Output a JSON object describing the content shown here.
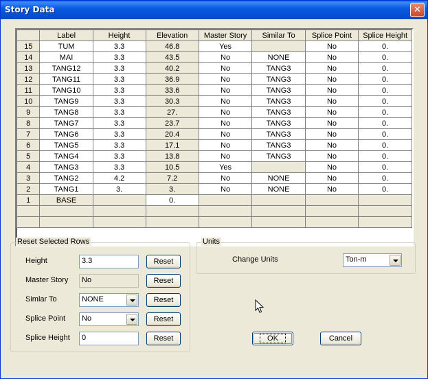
{
  "window": {
    "title": "Story Data"
  },
  "grid": {
    "headers": [
      "",
      "Label",
      "Height",
      "Elevation",
      "Master Story",
      "Similar To",
      "Splice Point",
      "Splice Height"
    ],
    "rows": [
      [
        "15",
        "TUM",
        "3.3",
        "46.8",
        "Yes",
        "",
        "No",
        "0."
      ],
      [
        "14",
        "MAI",
        "3.3",
        "43.5",
        "No",
        "NONE",
        "No",
        "0."
      ],
      [
        "13",
        "TANG12",
        "3.3",
        "40.2",
        "No",
        "TANG3",
        "No",
        "0."
      ],
      [
        "12",
        "TANG11",
        "3.3",
        "36.9",
        "No",
        "TANG3",
        "No",
        "0."
      ],
      [
        "11",
        "TANG10",
        "3.3",
        "33.6",
        "No",
        "TANG3",
        "No",
        "0."
      ],
      [
        "10",
        "TANG9",
        "3.3",
        "30.3",
        "No",
        "TANG3",
        "No",
        "0."
      ],
      [
        "9",
        "TANG8",
        "3.3",
        "27.",
        "No",
        "TANG3",
        "No",
        "0."
      ],
      [
        "8",
        "TANG7",
        "3.3",
        "23.7",
        "No",
        "TANG3",
        "No",
        "0."
      ],
      [
        "7",
        "TANG6",
        "3.3",
        "20.4",
        "No",
        "TANG3",
        "No",
        "0."
      ],
      [
        "6",
        "TANG5",
        "3.3",
        "17.1",
        "No",
        "TANG3",
        "No",
        "0."
      ],
      [
        "5",
        "TANG4",
        "3.3",
        "13.8",
        "No",
        "TANG3",
        "No",
        "0."
      ],
      [
        "4",
        "TANG3",
        "3.3",
        "10.5",
        "Yes",
        "",
        "No",
        "0."
      ],
      [
        "3",
        "TANG2",
        "4.2",
        "7.2",
        "No",
        "NONE",
        "No",
        "0."
      ],
      [
        "2",
        "TANG1",
        "3.",
        "3.",
        "No",
        "NONE",
        "No",
        "0."
      ],
      [
        "1",
        "BASE",
        "",
        "0.",
        "",
        "",
        "",
        ""
      ]
    ]
  },
  "reset": {
    "group_label": "Reset Selected Rows",
    "height_label": "Height",
    "height_value": "3.3",
    "master_label": "Master Story",
    "master_value": "No",
    "similar_label": "Simlar To",
    "similar_value": "NONE",
    "splice_point_label": "Splice Point",
    "splice_point_value": "No",
    "splice_height_label": "Splice Height",
    "splice_height_value": "0",
    "reset_label": "Reset"
  },
  "units": {
    "group_label": "Units",
    "change_label": "Change Units",
    "value": "Ton-m"
  },
  "buttons": {
    "ok": "OK",
    "cancel": "Cancel"
  }
}
